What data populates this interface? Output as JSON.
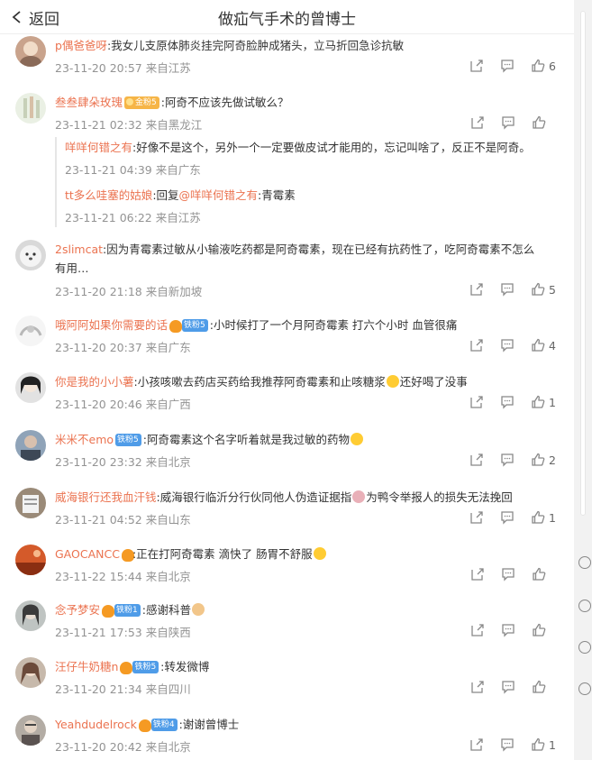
{
  "header": {
    "back_label": "返回",
    "title": "做疝气手术的曾博士"
  },
  "comments": [
    {
      "user": "p偶爸爸呀",
      "text": ":我女儿支原体肺炎挂完阿奇脸肿成猪头，立马折回急诊抗敏",
      "time": "23-11-20 20:57 来自江苏",
      "likes": "6"
    },
    {
      "user": "叁叁肆朵玫瑰",
      "badge": "金粉5",
      "text": ":阿奇不应该先做试敏么？",
      "time": "23-11-21 02:32 来自黑龙江",
      "likes": "",
      "replies": [
        {
          "user": "咩咩何错之有",
          "text": ":好像不是这个，另外一个一定要做皮试才能用的，忘记叫啥了，反正不是阿奇。",
          "time": "23-11-21 04:39 来自广东"
        },
        {
          "user": "tt多么哇塞的姑娘",
          "text_prefix": ":回复",
          "mention": "@咩咩何错之有",
          "text": ":青霉素",
          "time": "23-11-21 06:22 来自江苏"
        }
      ]
    },
    {
      "user": "2slimcat",
      "text": ":因为青霉素过敏从小输液吃药都是阿奇霉素，现在已经有抗药性了，吃阿奇霉素不怎么",
      "text2": "有用…",
      "time": "23-11-20 21:18 来自新加坡",
      "likes": "5"
    },
    {
      "user": "哦阿阿如果你需要的话",
      "badge": "铁粉5",
      "text": ":小时候打了一个月阿奇霉素 打六个小时 血管很痛",
      "time": "23-11-20 20:37 来自广东",
      "likes": "4"
    },
    {
      "user": "你是我的小小薯",
      "text": ":小孩咳嗽去药店买药给我推荐阿奇霉素和止咳糖浆",
      "text_after": "还好喝了没事",
      "time": "23-11-20 20:46 来自广西",
      "likes": "1"
    },
    {
      "user": "米米不emo",
      "badge": "铁粉5",
      "text": ":阿奇霉素这个名字听着就是我过敏的药物",
      "time": "23-11-20 23:32 来自北京",
      "likes": "2"
    },
    {
      "user": "威海银行还我血汗钱",
      "text": ":威海银行临沂分行伙同他人伪造证据指",
      "text_after": "为鸭令举报人的损失无法挽回",
      "time": "23-11-21 04:52 来自山东",
      "likes": "1"
    },
    {
      "user": "GAOCANCC",
      "text": ":正在打阿奇霉素 滴快了 肠胃不舒服",
      "time": "23-11-22 15:44 来自北京",
      "likes": ""
    },
    {
      "user": "念予梦安",
      "badge": "铁粉1",
      "text": ":感谢科普",
      "time": "23-11-21 17:53 来自陕西",
      "likes": ""
    },
    {
      "user": "汪仔牛奶糖n",
      "badge": "铁粉5",
      "text": ":转发微博",
      "time": "23-11-20 21:34 来自四川",
      "likes": ""
    },
    {
      "user": "Yeahdudelrock",
      "badge": "铁粉4",
      "text": ":谢谢曾博士",
      "time": "23-11-20 20:42 来自北京",
      "likes": "1"
    }
  ]
}
